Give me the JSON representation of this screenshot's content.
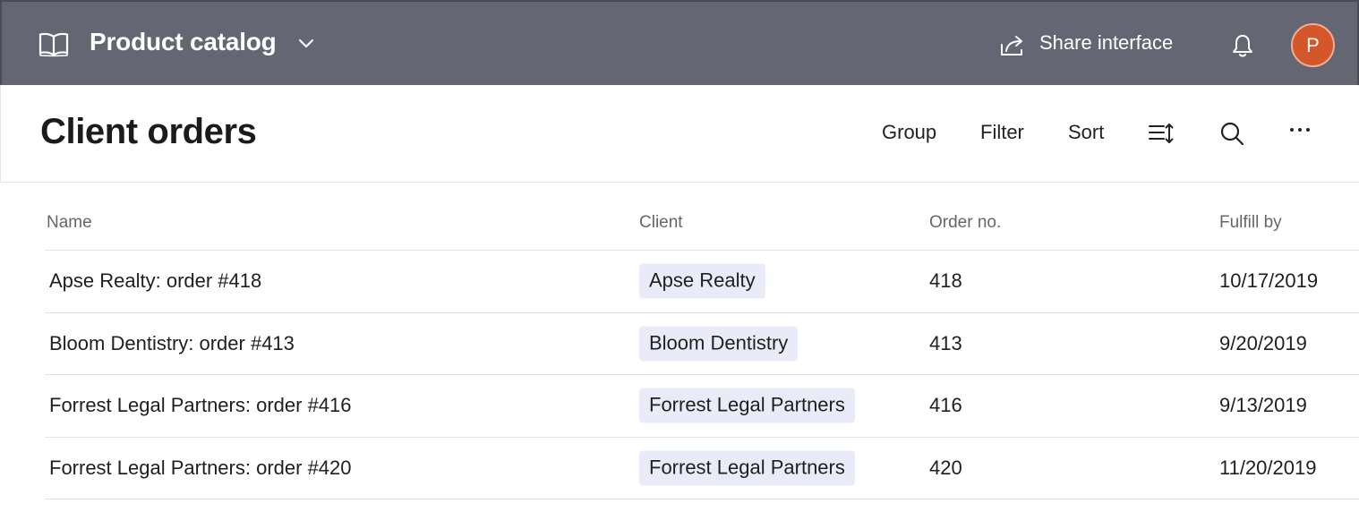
{
  "header": {
    "app_title": "Product catalog",
    "share_label": "Share interface",
    "avatar_initial": "P",
    "avatar_color": "#d4572c",
    "bar_color": "#646773",
    "icons": [
      "book-icon",
      "chevron-down-icon",
      "share-icon",
      "bell-icon"
    ]
  },
  "toolbar": {
    "page_title": "Client orders",
    "group_label": "Group",
    "filter_label": "Filter",
    "sort_label": "Sort",
    "icons": [
      "row-height-icon",
      "search-icon",
      "more-icon"
    ]
  },
  "table": {
    "columns": [
      "Name",
      "Client",
      "Order no.",
      "Fulfill by"
    ],
    "chip_color": "#e9ecf8",
    "rows": [
      {
        "name": "Apse Realty: order #418",
        "client": "Apse Realty",
        "order_no": "418",
        "fulfill_by": "10/17/2019"
      },
      {
        "name": "Bloom Dentistry: order #413",
        "client": "Bloom Dentistry",
        "order_no": "413",
        "fulfill_by": "9/20/2019"
      },
      {
        "name": "Forrest Legal Partners: order #416",
        "client": "Forrest Legal Partners",
        "order_no": "416",
        "fulfill_by": "9/13/2019"
      },
      {
        "name": "Forrest Legal Partners: order #420",
        "client": "Forrest Legal Partners",
        "order_no": "420",
        "fulfill_by": "11/20/2019"
      }
    ]
  }
}
